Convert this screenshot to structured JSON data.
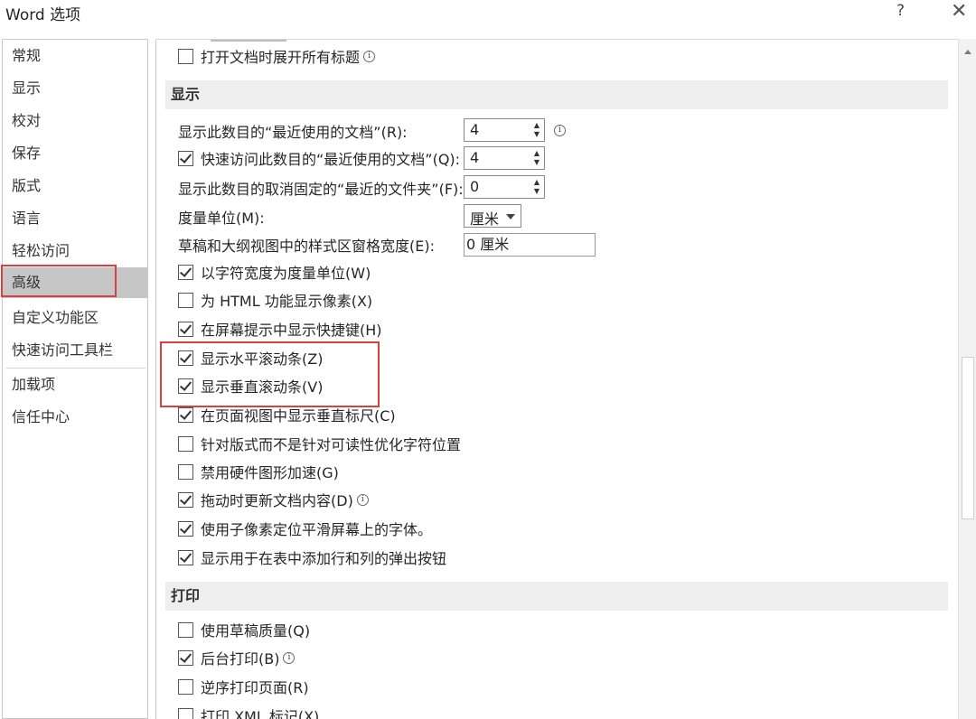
{
  "window": {
    "title": "Word 选项",
    "help_label": "?",
    "close_label": "✕"
  },
  "sidebar": {
    "items": [
      {
        "label": "常规"
      },
      {
        "label": "显示"
      },
      {
        "label": "校对"
      },
      {
        "label": "保存"
      },
      {
        "label": "版式"
      },
      {
        "label": "语言"
      },
      {
        "label": "轻松访问"
      },
      {
        "label": "高级",
        "selected": true
      },
      {
        "label": "自定义功能区"
      },
      {
        "label": "快速访问工具栏"
      },
      {
        "label": "加载项"
      },
      {
        "label": "信任中心"
      }
    ]
  },
  "options": {
    "top_row": {
      "label": "打开文档时展开所有标题",
      "checked": false
    },
    "display_section": {
      "title": "显示",
      "recent_docs": {
        "label": "显示此数目的“最近使用的文档”(R):",
        "value": "4"
      },
      "quick_access_docs": {
        "label": "快速访问此数目的“最近使用的文档”(Q):",
        "value": "4",
        "checked": true
      },
      "unpinned_folders": {
        "label": "显示此数目的取消固定的“最近的文件夹”(F):",
        "value": "0"
      },
      "measure_unit": {
        "label": "度量单位(M):",
        "value": "厘米"
      },
      "style_area_width": {
        "label": "草稿和大纲视图中的样式区窗格宽度(E):",
        "value": "0 厘米"
      },
      "checkboxes": [
        {
          "label": "以字符宽度为度量单位(W)",
          "checked": true
        },
        {
          "label": "为 HTML 功能显示像素(X)",
          "checked": false
        },
        {
          "label": "在屏幕提示中显示快捷键(H)",
          "checked": true
        },
        {
          "label": "显示水平滚动条(Z)",
          "checked": true
        },
        {
          "label": "显示垂直滚动条(V)",
          "checked": true
        },
        {
          "label": "在页面视图中显示垂直标尺(C)",
          "checked": true
        },
        {
          "label": "针对版式而不是针对可读性优化字符位置",
          "checked": false
        },
        {
          "label": "禁用硬件图形加速(G)",
          "checked": false
        },
        {
          "label": "拖动时更新文档内容(D)",
          "checked": true
        },
        {
          "label": "使用子像素定位平滑屏幕上的字体。",
          "checked": true
        },
        {
          "label": "显示用于在表中添加行和列的弹出按钮",
          "checked": true
        }
      ]
    },
    "print_section": {
      "title": "打印",
      "checkboxes": [
        {
          "label": "使用草稿质量(Q)",
          "checked": false
        },
        {
          "label": "后台打印(B)",
          "checked": true
        },
        {
          "label": "逆序打印页面(R)",
          "checked": false
        },
        {
          "label": "打印 XML 标记(X)",
          "checked": false
        }
      ]
    }
  },
  "colors": {
    "highlight_red": "#d9403e",
    "selected_nav_bg": "#c6c6c6",
    "section_header_bg": "#eeeeee"
  }
}
